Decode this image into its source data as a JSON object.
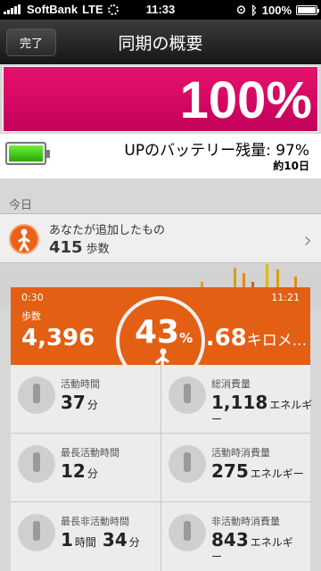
{
  "status_bar": {
    "carrier": "SoftBank",
    "network": "LTE",
    "time": "11:33",
    "battery": "100%"
  },
  "nav": {
    "done_label": "完了",
    "title": "同期の概要"
  },
  "battery_level": {
    "percent_text": "100%",
    "fill": 1.0
  },
  "up_battery": {
    "label": "UPのバッテリー残量: 97%",
    "days": "約10日",
    "fill": 0.97
  },
  "section_today": "今日",
  "added_row": {
    "label": "あなたが追加したもの",
    "value": "415",
    "unit": "歩数"
  },
  "timeline": {
    "start": "0:30",
    "end": "11:21"
  },
  "steps": {
    "label": "歩数",
    "value": "4,396"
  },
  "goal": {
    "value": "43",
    "unit": "%"
  },
  "distance": {
    "value": ".68",
    "unit": "キロメ..."
  },
  "stats": [
    {
      "label": "活動時間",
      "v1": "37",
      "u1": "分",
      "v2": "",
      "u2": ""
    },
    {
      "label": "総消費量",
      "v1": "1,118",
      "u1": "エネルギ",
      "v2": "",
      "u2": "ー"
    },
    {
      "label": "最長活動時間",
      "v1": "12",
      "u1": "分",
      "v2": "",
      "u2": ""
    },
    {
      "label": "活動時消費量",
      "v1": "275",
      "u1": "エネルギー",
      "v2": "",
      "u2": ""
    },
    {
      "label": "最長非活動時間",
      "v1": "1",
      "u1": "時間",
      "v2": "34",
      "u2": "分"
    },
    {
      "label": "非活動時消費量",
      "v1": "843",
      "u1": "エネルギ",
      "v2": "",
      "u2": "ー"
    }
  ],
  "colors": {
    "pink": "#d6056a",
    "orange": "#e35f14",
    "green_battery": "#3ed70f"
  }
}
